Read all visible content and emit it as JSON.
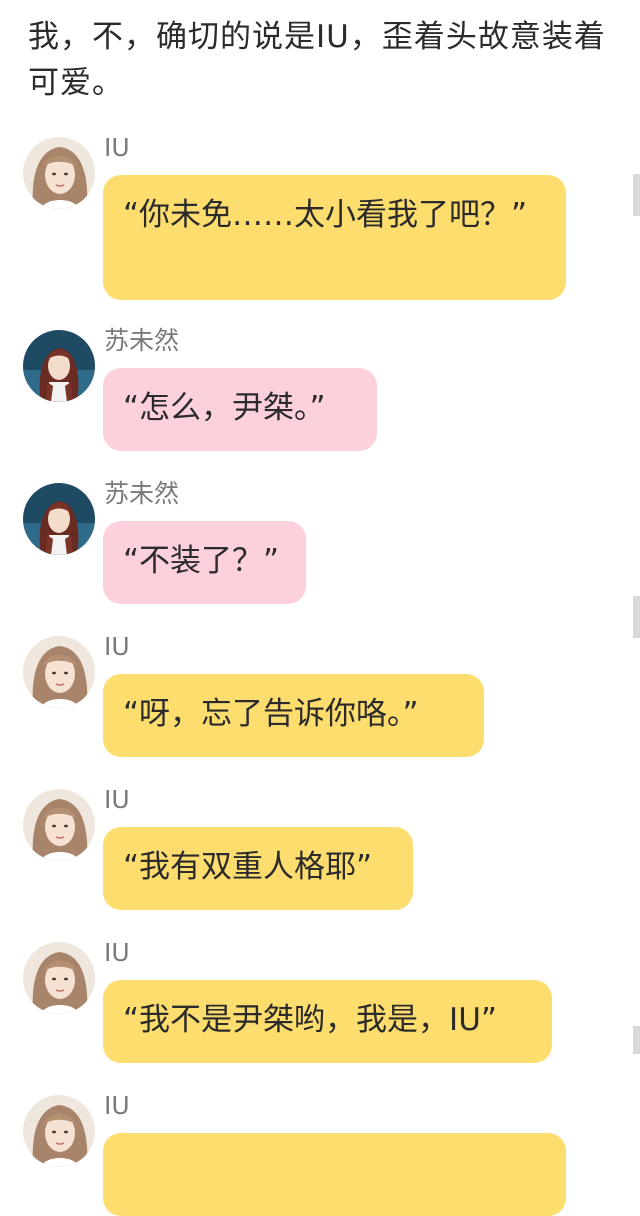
{
  "narration": "我，不，确切的说是IU，歪着头故意装着可爱。",
  "messages": [
    {
      "sender": "IU",
      "text": "“你未免……太小看我了吧？”",
      "color": "yellow",
      "avatar": "iu-avatar-icon"
    },
    {
      "sender": "苏未然",
      "text": "“怎么，尹桀。”",
      "color": "pink",
      "avatar": "suweiran-avatar-icon"
    },
    {
      "sender": "苏未然",
      "text": "“不装了？”",
      "color": "pink",
      "avatar": "suweiran-avatar-icon"
    },
    {
      "sender": "IU",
      "text": "“呀，忘了告诉你咯。”",
      "color": "yellow",
      "avatar": "iu-avatar-icon"
    },
    {
      "sender": "IU",
      "text": "“我有双重人格耶”",
      "color": "yellow",
      "avatar": "iu-avatar-icon"
    },
    {
      "sender": "IU",
      "text": "“我不是尹桀哟，我是，IU”",
      "color": "yellow",
      "avatar": "iu-avatar-icon"
    },
    {
      "sender": "IU",
      "text": "",
      "color": "yellow",
      "avatar": "iu-avatar-icon"
    }
  ],
  "colors": {
    "yellow_bubble": "#fddd6e",
    "pink_bubble": "#fdd1dc",
    "name_text": "#7a7a7a"
  }
}
